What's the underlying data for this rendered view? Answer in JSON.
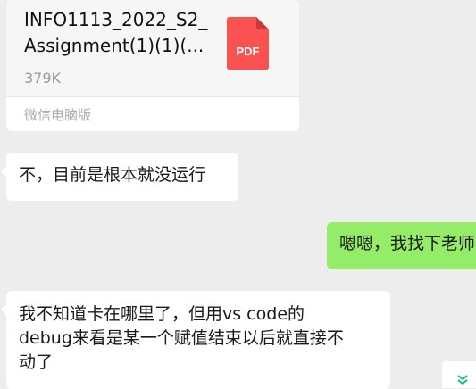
{
  "file_message": {
    "file_name_line1": "INFO1113_2022_S2_",
    "file_name_line2": "Assignment(1)(1)(...",
    "file_size": "379K",
    "file_type_label": "PDF",
    "source": "微信电脑版",
    "icon": "pdf-file-icon",
    "icon_color": "#fa5151"
  },
  "messages": [
    {
      "direction": "incoming",
      "text": "不，目前是根本就没运行"
    },
    {
      "direction": "outgoing",
      "text": "嗯嗯，我找下老师"
    },
    {
      "direction": "incoming",
      "lines": [
        "我不知道卡在哪里了，但用vs code的",
        "debug来看是某一个赋值结束以后就直接不",
        "动了"
      ]
    }
  ],
  "scroll_button": {
    "icon": "chevron-double-down-icon",
    "color": "#07c160"
  },
  "colors": {
    "background": "#ededed",
    "incoming_bubble": "#ffffff",
    "outgoing_bubble": "#95ec69"
  }
}
